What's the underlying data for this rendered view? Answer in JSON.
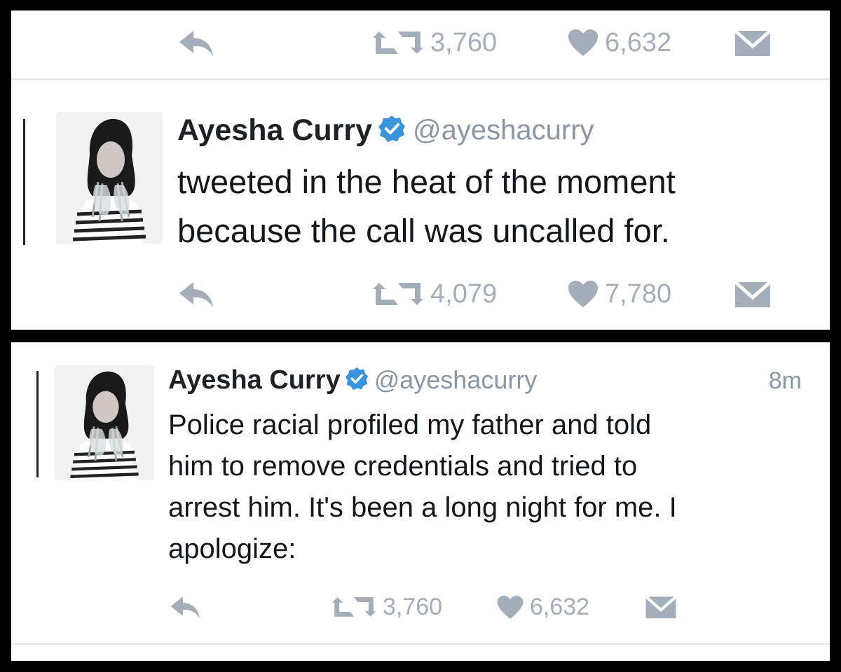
{
  "panel1": {
    "top_actions": {
      "retweets": "3,760",
      "likes": "6,632"
    },
    "tweet": {
      "name": "Ayesha Curry",
      "handle": "@ayeshacurry",
      "text_line1": "tweeted in the heat of the moment",
      "text_line2": "because the call was uncalled for.",
      "retweets": "4,079",
      "likes": "7,780"
    }
  },
  "panel2": {
    "tweet": {
      "name": "Ayesha Curry",
      "handle": "@ayeshacurry",
      "time": "8m",
      "text_line1": "Police racial profiled my father and told",
      "text_line2": "him to remove credentials and tried to",
      "text_line3": "arrest him. It's been a long night for me. I",
      "text_line4": "apologize:",
      "retweets": "3,760",
      "likes": "6,632"
    }
  },
  "icons": [
    "reply-icon",
    "retweet-icon",
    "like-icon",
    "direct-message-icon",
    "verified-badge-icon"
  ],
  "colors": {
    "action_gray": "#a3aeb8",
    "verified_blue": "#3b94d9",
    "text": "#14171a",
    "handle_gray": "#8a97a3"
  }
}
